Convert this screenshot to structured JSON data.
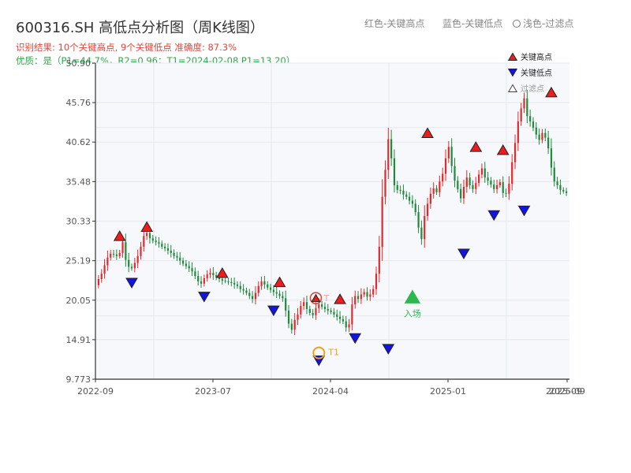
{
  "header": {
    "title": "600316.SH 高低点分析图（周K线图）",
    "legend_red": "红色-关键高点",
    "legend_blue": "蓝色-关键低点",
    "legend_filtered": "浅色-过滤点",
    "result_line": "识别结果: 10个关键高点, 9个关键低点  准确度: 87.3%",
    "quality_line": "优质：是（P1=44.7%，R2=0.96；T1=2024-02-08 P1=13.20）"
  },
  "colors": {
    "up": "#e8272a",
    "down": "#1e8a3a",
    "high_marker": "#ee1c1c",
    "low_marker": "#1414e0",
    "entry": "#2cb84e",
    "t1": "#f0a020",
    "grid": "#e4e8ee",
    "plot_bg": "#f6f8fb"
  },
  "chart_data": {
    "type": "candlestick",
    "ylim": [
      9.773,
      50.9
    ],
    "yticks": [
      9.773,
      14.91,
      20.05,
      25.19,
      30.33,
      35.48,
      40.62,
      45.76,
      50.9
    ],
    "ytick_labels": [
      "9.773",
      "14.91",
      "20.05",
      "25.19",
      "30.33",
      "35.48",
      "40.62",
      "45.76",
      "50.90"
    ],
    "xticks": [
      "2022-09",
      "2023-07",
      "2024-04",
      "2025-01",
      "2025-09"
    ],
    "xtick_overlap_label": "2025-09",
    "n_weeks": 156,
    "closes": [
      22.8,
      23.5,
      24.6,
      25.6,
      26.1,
      26.0,
      25.8,
      26.2,
      27.6,
      25.3,
      24.4,
      24.2,
      24.9,
      25.8,
      27.0,
      28.4,
      28.8,
      28.1,
      27.8,
      27.6,
      27.4,
      27.0,
      26.8,
      26.5,
      26.2,
      25.8,
      25.6,
      25.2,
      24.8,
      24.5,
      24.2,
      23.8,
      23.2,
      22.5,
      22.2,
      22.9,
      23.4,
      23.6,
      23.3,
      23.0,
      22.8,
      22.6,
      22.5,
      22.4,
      22.3,
      22.1,
      21.9,
      21.5,
      21.3,
      21.0,
      20.6,
      20.2,
      21.0,
      21.9,
      22.5,
      22.1,
      21.7,
      21.4,
      21.1,
      20.9,
      20.6,
      20.3,
      18.7,
      17.0,
      16.2,
      17.5,
      18.2,
      19.3,
      19.8,
      18.9,
      18.4,
      18.1,
      19.0,
      19.5,
      19.2,
      18.9,
      18.7,
      18.5,
      18.2,
      17.9,
      17.6,
      17.3,
      16.5,
      16.9,
      19.5,
      20.6,
      20.2,
      20.8,
      21.1,
      20.5,
      20.8,
      21.5,
      23.5,
      27.0,
      33.5,
      37.0,
      41.0,
      38.5,
      35.0,
      34.4,
      34.3,
      33.8,
      33.5,
      33.0,
      32.6,
      31.5,
      29.5,
      28.0,
      31.0,
      32.6,
      33.9,
      34.6,
      34.1,
      35.5,
      36.5,
      38.5,
      40.0,
      37.5,
      35.6,
      34.5,
      33.3,
      34.8,
      36.0,
      35.0,
      34.5,
      35.3,
      36.4,
      37.2,
      36.0,
      35.6,
      35.1,
      34.5,
      35.0,
      35.4,
      34.0,
      33.9,
      35.2,
      38.0,
      40.5,
      43.3,
      45.0,
      46.3,
      44.0,
      43.3,
      42.5,
      41.6,
      40.9,
      41.8,
      41.2,
      39.8,
      37.3,
      35.5,
      35.0,
      34.4,
      34.2,
      34.0
    ],
    "key_highs": [
      {
        "week": 7,
        "value": 27.6
      },
      {
        "week": 16,
        "value": 28.8
      },
      {
        "week": 41,
        "value": 22.8
      },
      {
        "week": 60,
        "value": 21.6
      },
      {
        "week": 80,
        "value": 19.4
      },
      {
        "week": 109,
        "value": 41.0
      },
      {
        "week": 125,
        "value": 39.2
      },
      {
        "week": 134,
        "value": 38.8
      },
      {
        "week": 150,
        "value": 46.3
      }
    ],
    "filtered_high": {
      "week": 72,
      "value": 19.6,
      "label": "T"
    },
    "key_lows": [
      {
        "week": 11,
        "value": 23.0
      },
      {
        "week": 35,
        "value": 21.2
      },
      {
        "week": 58,
        "value": 19.4
      },
      {
        "week": 73,
        "value": 12.9
      },
      {
        "week": 85,
        "value": 15.8
      },
      {
        "week": 96,
        "value": 14.4
      },
      {
        "week": 121,
        "value": 26.8
      },
      {
        "week": 131,
        "value": 31.8
      },
      {
        "week": 141,
        "value": 32.4
      }
    ],
    "t1": {
      "week": 73,
      "value": 13.2,
      "label": "T1"
    },
    "entry": {
      "week": 104,
      "value": 20.3,
      "label": "入场"
    },
    "legend": {
      "placement": "top-right",
      "items": [
        {
          "label": "关键高点",
          "kind": "high"
        },
        {
          "label": "关键低点",
          "kind": "low"
        },
        {
          "label": "过滤点",
          "kind": "filtered"
        }
      ]
    }
  }
}
